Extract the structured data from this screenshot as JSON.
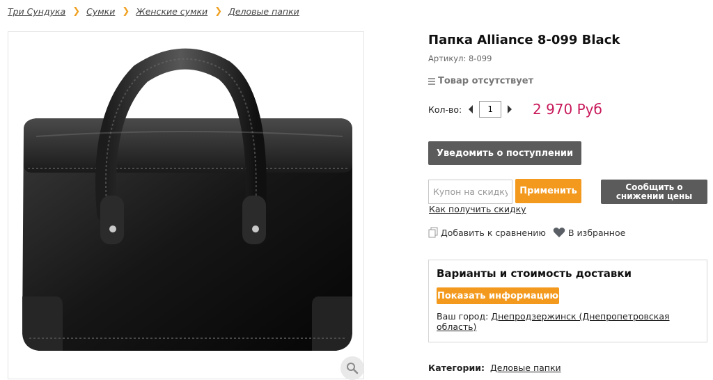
{
  "breadcrumb": [
    {
      "label": "Три Сундука"
    },
    {
      "label": "Сумки"
    },
    {
      "label": "Женские сумки"
    },
    {
      "label": "Деловые папки"
    }
  ],
  "product": {
    "title": "Папка Alliance 8-099 Black",
    "sku_label": "Артикул:",
    "sku_value": "8-099",
    "stock_status": "Товар отсутствует",
    "qty_label": "Кол-во:",
    "qty_value": "1",
    "price": "2 970 Руб"
  },
  "actions": {
    "notify_label": "Уведомить о поступлении",
    "coupon_placeholder": "Купон на скидку",
    "apply_label": "Применить",
    "report_price_label": "Сообщить о снижении цены",
    "coupon_help_link": "Как получить скидку",
    "compare_label": "Добавить к сравнению",
    "favorite_label": "В избранное"
  },
  "delivery": {
    "title": "Варианты и стоимость доставки",
    "show_info_label": "Показать информацию",
    "city_label": "Ваш город:",
    "city_value": "Днепродзержинск (Днепропетровская область)"
  },
  "categories": {
    "label": "Категории:",
    "value": "Деловые папки"
  },
  "colors": {
    "accent": "#f39a1e",
    "price": "#c8185a",
    "dark_button": "#5b5b5b"
  },
  "icons": [
    "chevron-right-icon",
    "list-icon",
    "arrow-left-icon",
    "arrow-right-icon",
    "compare-icon",
    "heart-icon",
    "magnifier-icon"
  ]
}
